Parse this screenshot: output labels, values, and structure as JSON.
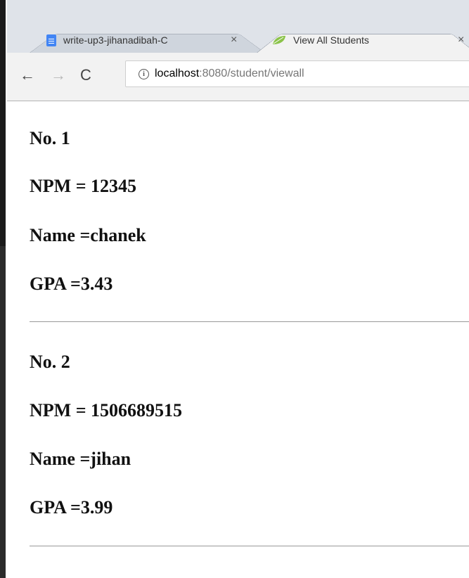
{
  "browser": {
    "tabs": [
      {
        "title": "write-up3-jihanadibah-C",
        "close": "×",
        "icon": "google-docs-icon",
        "active": false
      },
      {
        "title": "View All Students",
        "close": "×",
        "icon": "spring-leaf-icon",
        "active": true
      }
    ],
    "nav": {
      "back": "←",
      "forward": "→",
      "reload": "C"
    },
    "address": {
      "host": "localhost",
      "rest": ":8080/student/viewall",
      "info_icon": "i"
    }
  },
  "students": [
    {
      "no": "No. 1",
      "npm": "NPM = 12345",
      "name": "Name =chanek",
      "gpa": "GPA =3.43"
    },
    {
      "no": "No. 2",
      "npm": "NPM = 1506689515",
      "name": "Name =jihan",
      "gpa": "GPA =3.99"
    }
  ],
  "colors": {
    "accent": "#4285f4",
    "leaf": "#8bc34a",
    "rule": "#999999"
  }
}
